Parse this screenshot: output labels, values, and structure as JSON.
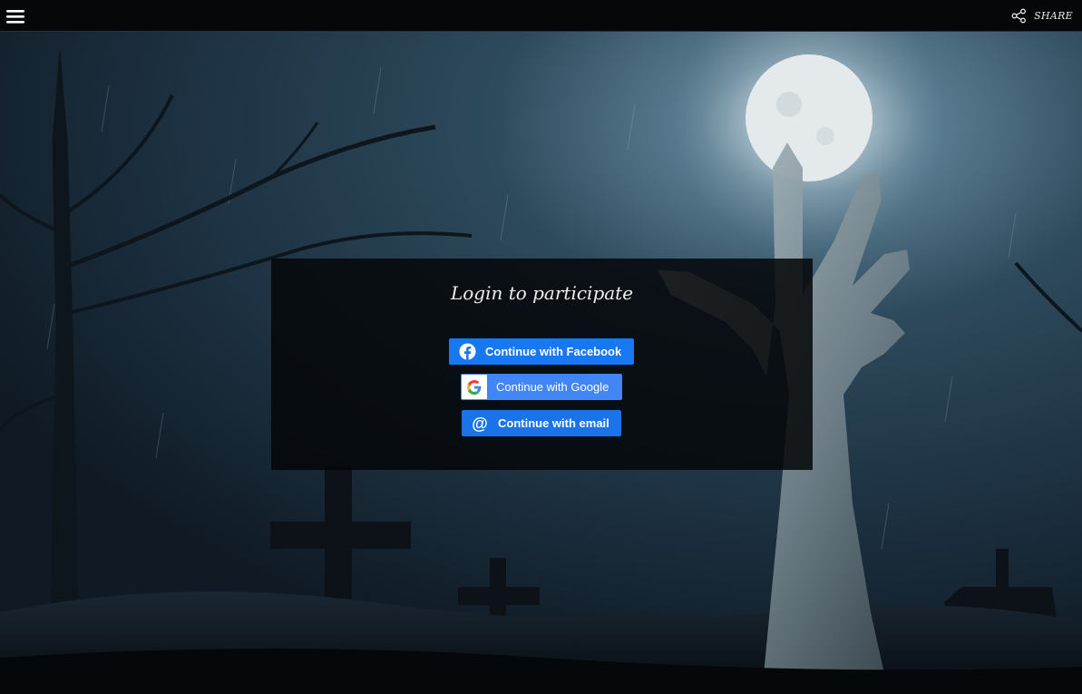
{
  "topbar": {
    "menu_icon": "hamburger-menu-icon",
    "share_icon": "share-icon",
    "share_label": "SHARE"
  },
  "background": {
    "description_icon": "graveyard-zombie-hand-scene"
  },
  "login": {
    "title": "Login to participate",
    "facebook_label": "Continue with Facebook",
    "google_label": "Continue with Google",
    "email_label": "Continue with email",
    "colors": {
      "facebook": "#1877f2",
      "google": "#4285f4",
      "email": "#1a73e8"
    }
  }
}
